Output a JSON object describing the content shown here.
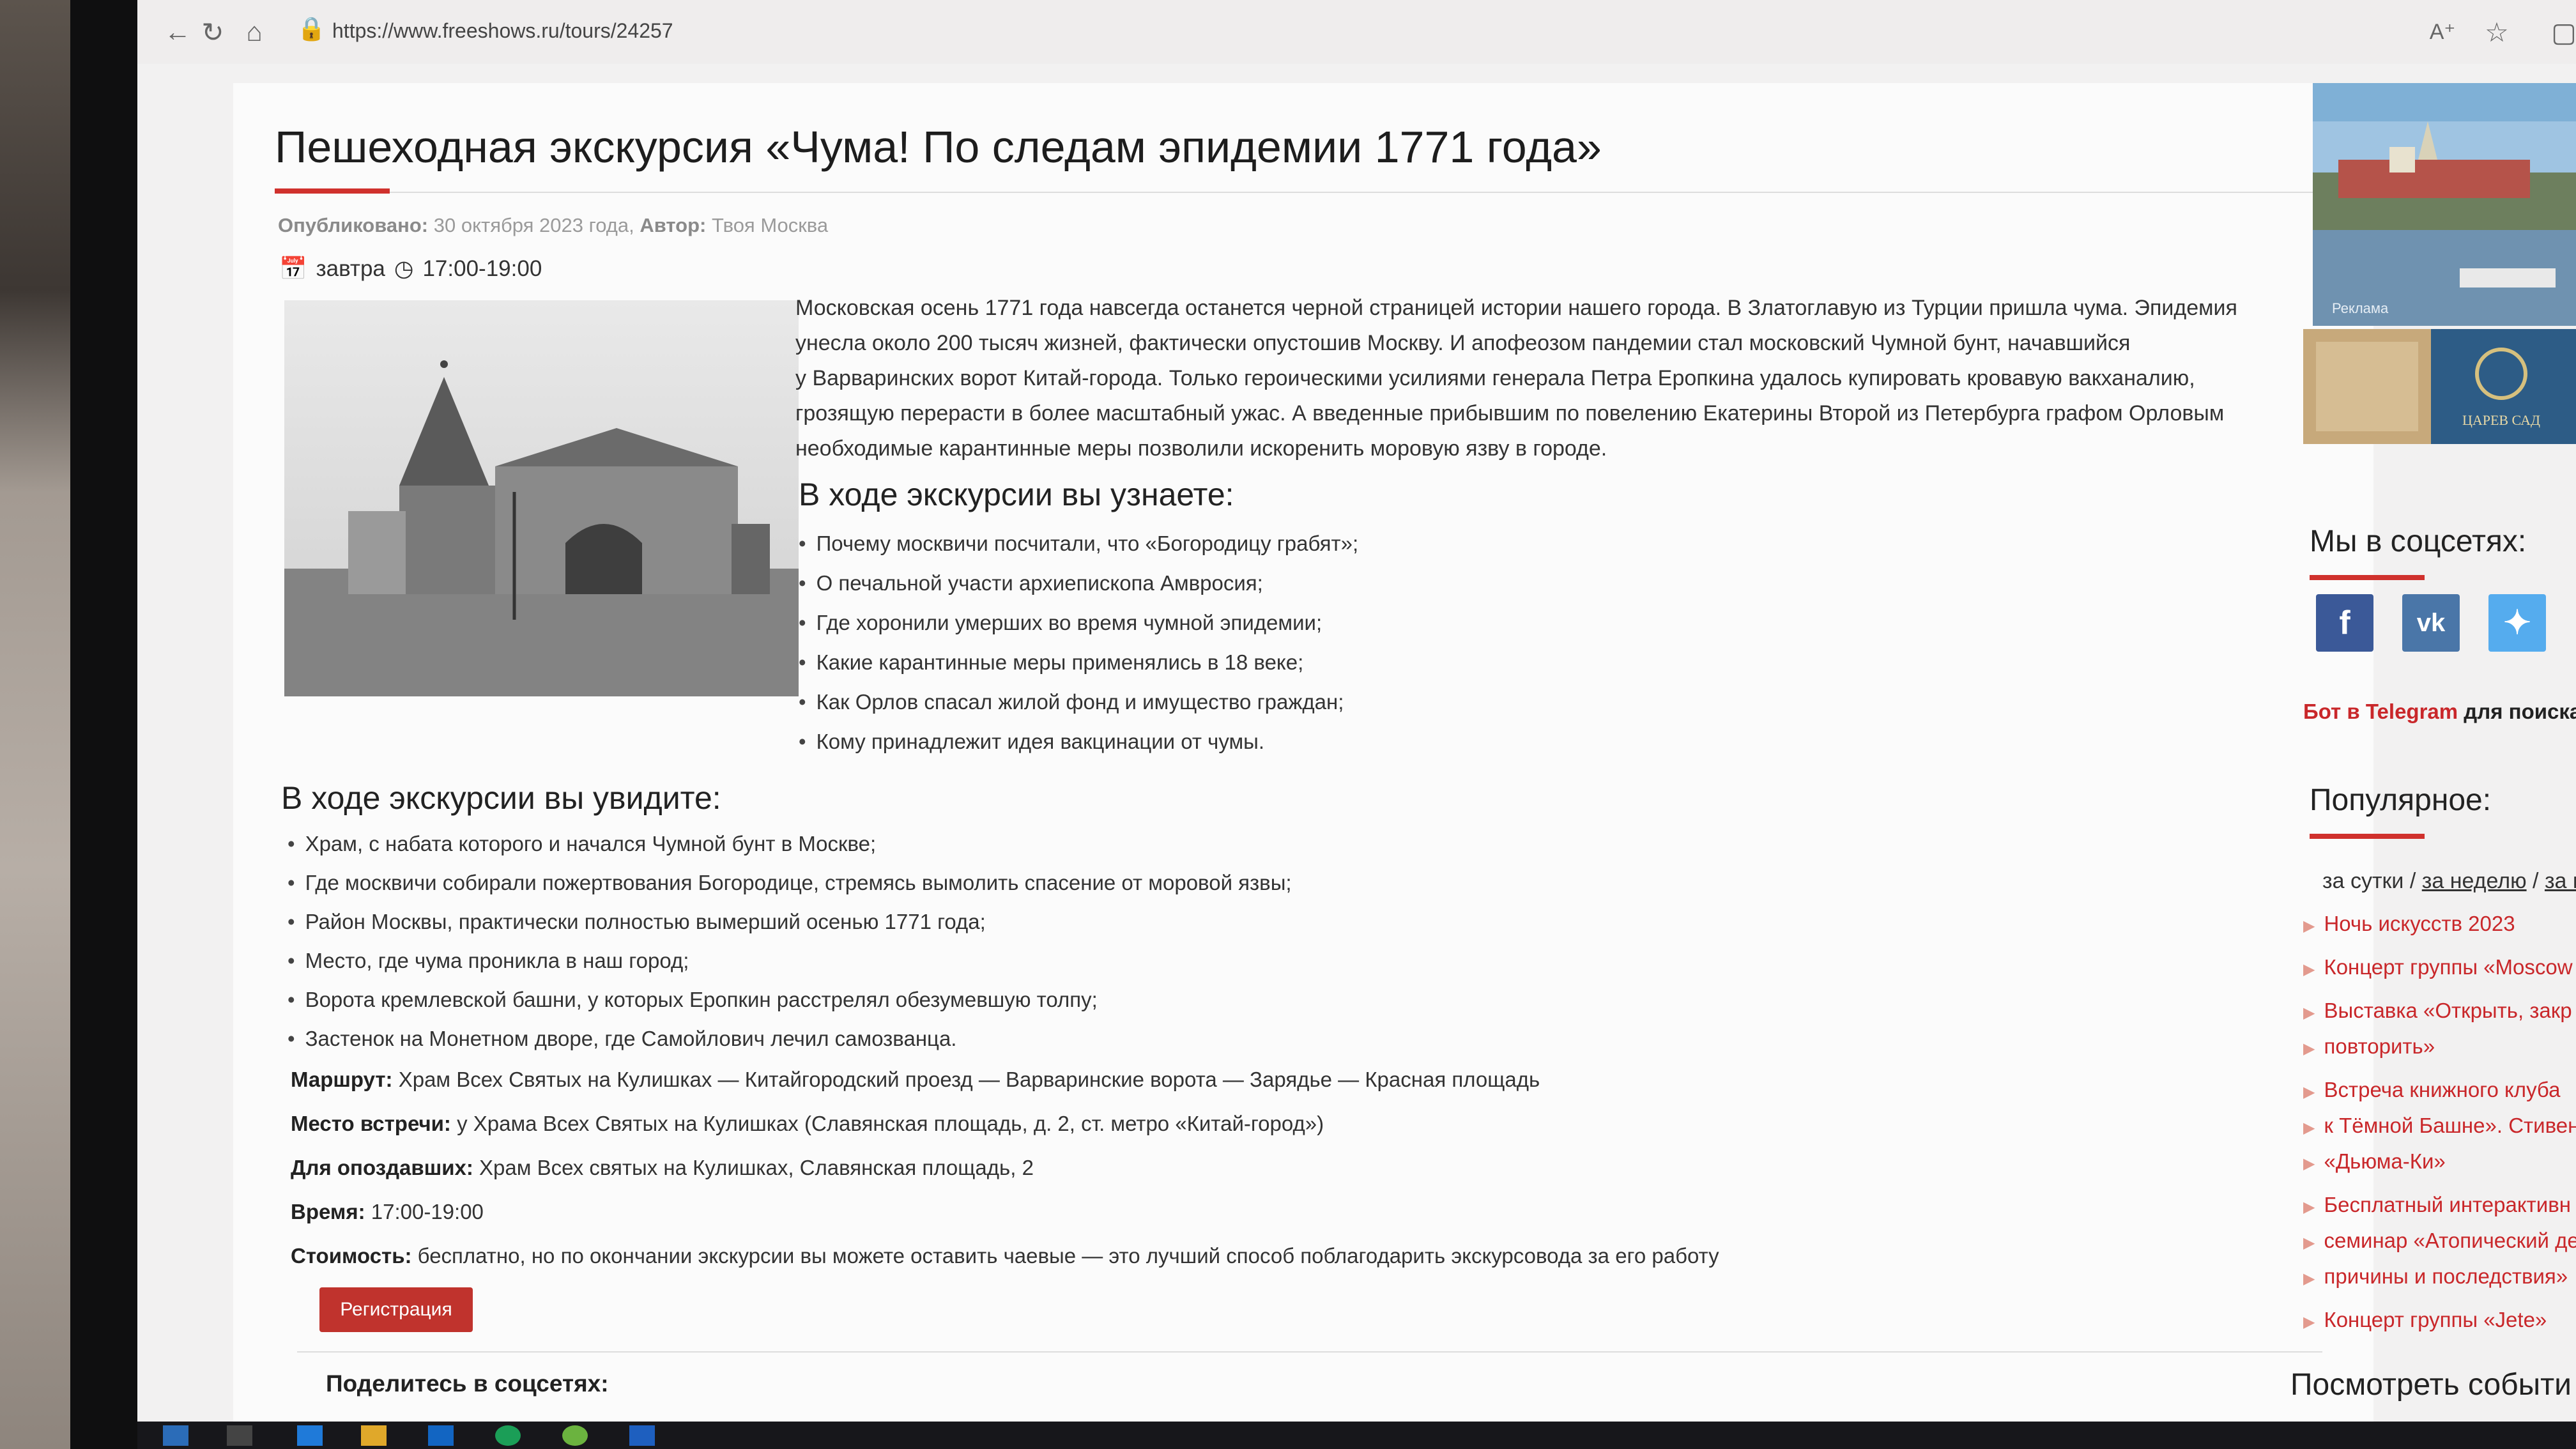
{
  "browser": {
    "url": "https://www.freeshows.ru/tours/24257"
  },
  "article": {
    "title": "Пешеходная экскурсия «Чума! По следам эпидемии 1771 года»",
    "meta": {
      "published_label": "Опубликовано:",
      "published_value": "30 октября 2023 года",
      "author_label": "Автор:",
      "author_value": "Твоя Москва"
    },
    "date": "завтра",
    "time": "17:00-19:00",
    "intro_lines": [
      "Московская осень 1771 года навсегда останется черной страницей истории нашего города. В Златоглавую из Турции пришла чума. Эпидемия",
      "унесла около 200 тысяч жизней, фактически опустошив Москву. И апофеозом пандемии стал московский Чумной бунт, начавшийся",
      "у Варваринских ворот Китай-города. Только героическими усилиями генерала Петра Еропкина удалось купировать кровавую вакханалию,",
      "грозящую перерасти в более масштабный ужас. А введенные прибывшим по повелению Екатерины Второй из Петербурга графом Орловым",
      "необходимые карантинные меры позволили искоренить моровую язву в городе."
    ],
    "learn_heading": "В ходе экскурсии вы узнаете:",
    "learn_items": [
      "Почему москвичи посчитали, что «Богородицу грабят»;",
      "О печальной участи архиепископа Амвросия;",
      "Где хоронили умерших во время чумной эпидемии;",
      "Какие карантинные меры применялись в 18 веке;",
      "Как Орлов спасал жилой фонд и имущество граждан;",
      "Кому принадлежит идея вакцинации от чумы."
    ],
    "see_heading": "В ходе экскурсии вы увидите:",
    "see_items": [
      "Храм, с набата которого и начался Чумной бунт в Москве;",
      "Где москвичи собирали пожертвования Богородице, стремясь вымолить спасение от моровой язвы;",
      "Район Москвы, практически полностью вымерший осенью 1771 года;",
      "Место, где чума проникла в наш город;",
      "Ворота кремлевской башни, у которых Еропкин расстрелял обезумевшую толпу;",
      "Застенок на Монетном дворе, где Самойлович лечил самозванца."
    ],
    "details": [
      {
        "label": "Маршрут:",
        "value": "Храм Всех Святых на Кулишках — Китайгородский проезд — Варваринские ворота — Зарядье — Красная площадь"
      },
      {
        "label": "Место встречи:",
        "value": "у Храма Всех Святых на Кулишках (Славянская площадь, д. 2, ст. метро «Китай-город»)"
      },
      {
        "label": "Для опоздавших:",
        "value": "Храм Всех святых на Кулишках, Славянская площадь, 2"
      },
      {
        "label": "Время:",
        "value": "17:00-19:00"
      },
      {
        "label": "Стоимость:",
        "value": "бесплатно, но по окончании экскурсии вы можете оставить чаевые — это лучший способ поблагодарить экскурсовода за его работу"
      }
    ],
    "register_button": "Регистрация",
    "share_label": "Поделитесь в соцсетях:"
  },
  "sidebar": {
    "ad_label": "Реклама",
    "ad2_text": "ЦАРЕВ САД",
    "social_heading": "Мы в соцсетях:",
    "social_icons": [
      "facebook-icon",
      "vk-icon",
      "twitter-icon"
    ],
    "telegram_link": "Бот в Telegram",
    "telegram_rest": "для поиска",
    "popular_heading": "Популярное:",
    "periods": {
      "day": "за сутки",
      "sep": "/",
      "week": "за неделю",
      "month": "за м"
    },
    "popular_items": [
      "Ночь искусств 2023",
      "Концерт группы «Moscow",
      "Выставка «Открыть, закр",
      "повторить»",
      "Встреча книжного клуба",
      "к Тёмной Башне». Стивен Ки",
      "«Дьюма-Ки»",
      "Бесплатный интерактивн",
      "семинар «Атопический дерм",
      "причины и последствия»",
      "Концерт группы «Jete»"
    ],
    "events_heading": "Посмотреть событи"
  },
  "colors": {
    "accent_red": "#c9272a",
    "facebook": "#3b5998",
    "vk": "#4a76a8",
    "twitter": "#55acee"
  }
}
